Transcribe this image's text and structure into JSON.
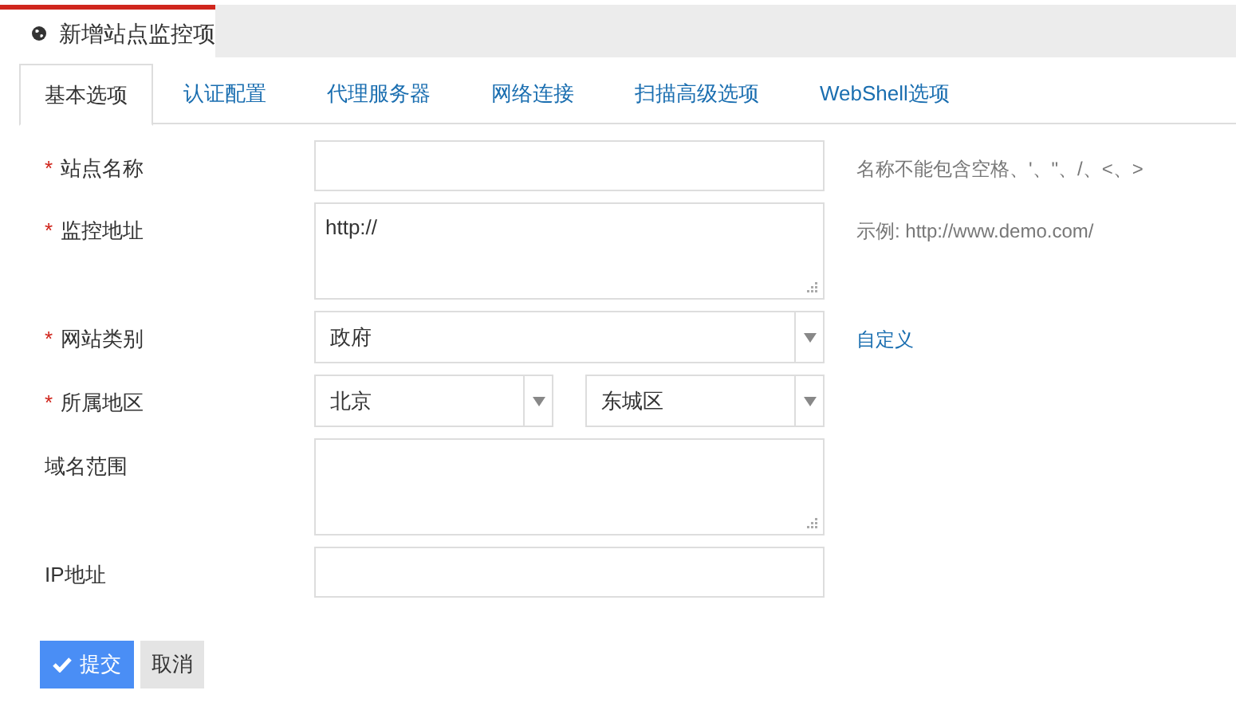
{
  "header": {
    "title": "新增站点监控项"
  },
  "tabs": [
    {
      "label": "基本选项",
      "selected": true
    },
    {
      "label": "认证配置",
      "selected": false
    },
    {
      "label": "代理服务器",
      "selected": false
    },
    {
      "label": "网络连接",
      "selected": false
    },
    {
      "label": "扫描高级选项",
      "selected": false
    },
    {
      "label": "WebShell选项",
      "selected": false
    }
  ],
  "fields": [
    {
      "kind": "input",
      "label": "站点名称",
      "mark": "*",
      "hint": "名称不能包含空格、'、\"、/、<、>"
    },
    {
      "kind": "textarea",
      "label": "监控地址",
      "mark": "*",
      "value": "http://",
      "hint": "示例: http://www.demo.com/"
    },
    {
      "kind": "select",
      "label": "网站类别",
      "mark": "*",
      "values": [
        "政府"
      ],
      "link": "自定义"
    },
    {
      "kind": "select",
      "label": "所属地区",
      "mark": "*",
      "values": [
        "北京",
        "东城区"
      ]
    },
    {
      "kind": "textarea",
      "label": "域名范围"
    },
    {
      "kind": "input",
      "label": "IP地址"
    }
  ],
  "buttons": [
    {
      "label": "提交",
      "kind": "primary"
    },
    {
      "label": "取消",
      "kind": "secondary"
    }
  ]
}
